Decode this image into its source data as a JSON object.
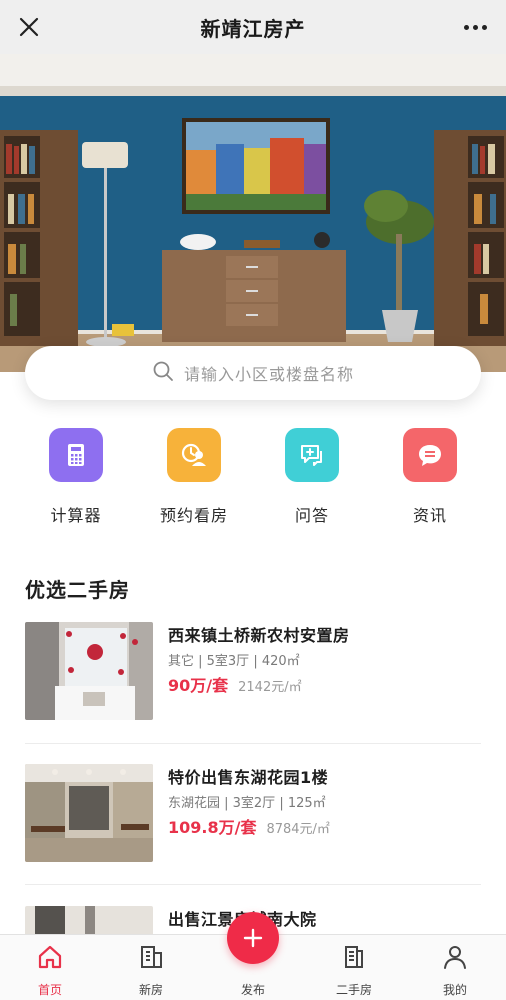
{
  "header": {
    "title": "新靖江房产"
  },
  "search": {
    "placeholder": "请输入小区或楼盘名称"
  },
  "quick_menu": [
    {
      "label": "计算器",
      "icon": "calculator-icon",
      "color": "#8e6ff0"
    },
    {
      "label": "预约看房",
      "icon": "appointment-icon",
      "color": "#f7b23a"
    },
    {
      "label": "问答",
      "icon": "qa-icon",
      "color": "#40cfd6"
    },
    {
      "label": "资讯",
      "icon": "news-icon",
      "color": "#f4666a"
    }
  ],
  "section": {
    "title": "优选二手房"
  },
  "listings": [
    {
      "name": "西来镇土桥新农村安置房",
      "meta": "其它 | 5室3厅 | 420㎡",
      "price": "90万/套",
      "unit_price": "2142元/㎡"
    },
    {
      "name": "特价出售东湖花园1楼",
      "meta": "东湖花园 | 3室2厅 | 125㎡",
      "price": "109.8万/套",
      "unit_price": "8784元/㎡"
    },
    {
      "name": "出售江景房城南大院"
    }
  ],
  "tabbar": {
    "home": "首页",
    "new_house": "新房",
    "publish": "发布",
    "second_hand": "二手房",
    "mine": "我的"
  },
  "colors": {
    "accent": "#e8324a",
    "header_bg": "#efefef"
  }
}
